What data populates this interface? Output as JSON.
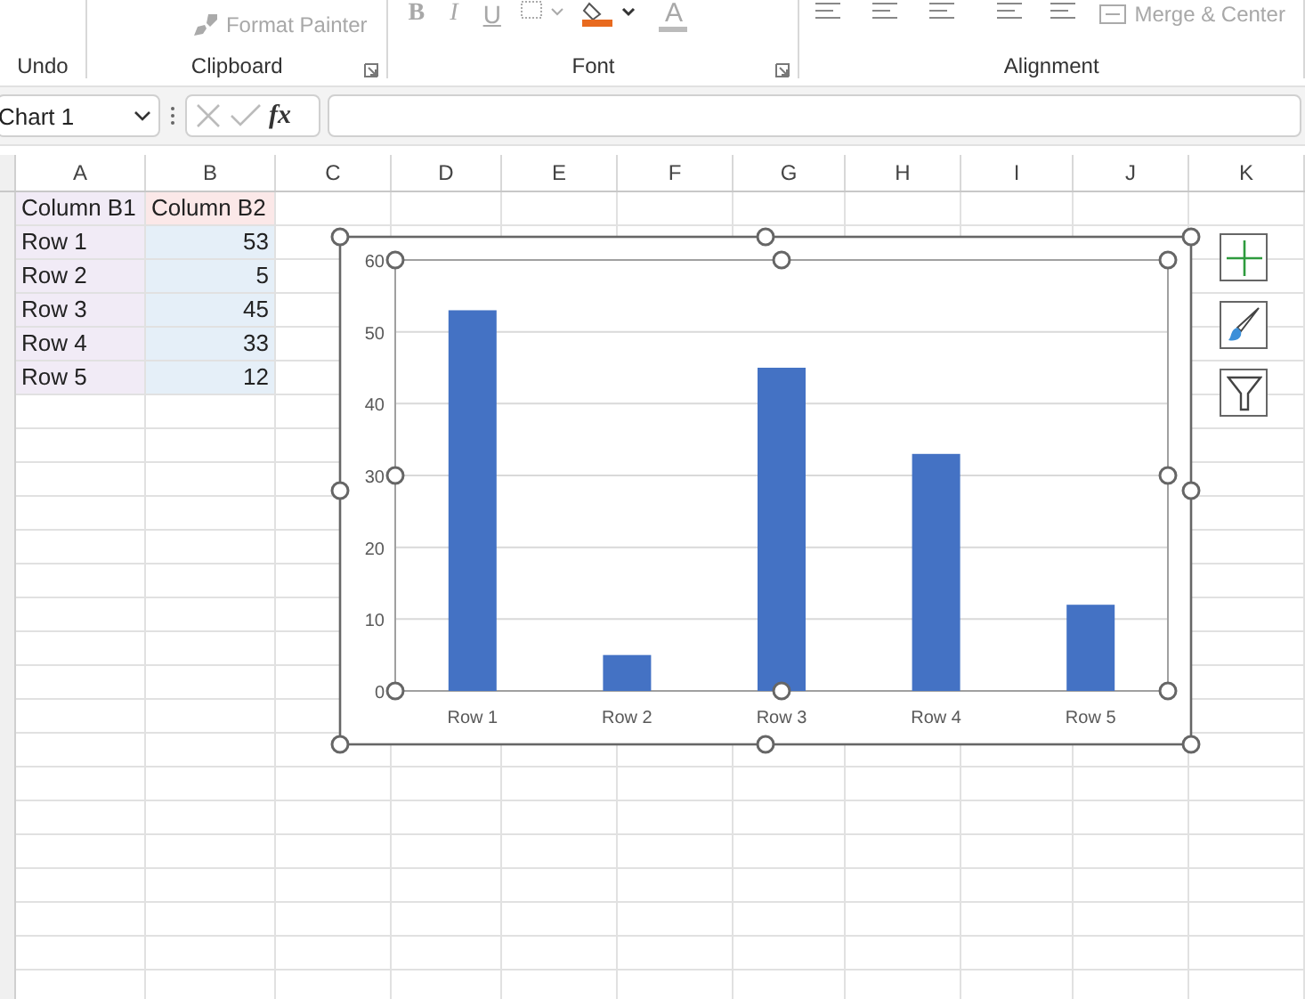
{
  "ribbon": {
    "format_painter": {
      "label": "Format Painter",
      "disabled": true
    },
    "font_buttons": [
      {
        "label": "B",
        "disabled": true
      },
      {
        "label": "I",
        "disabled": true
      },
      {
        "label": "U",
        "disabled": true
      }
    ],
    "font_color": {
      "label": "A",
      "disabled": true
    },
    "merge_center": {
      "label": "Merge & Center",
      "disabled": true
    },
    "groups": [
      {
        "label": "Undo"
      },
      {
        "label": "Clipboard"
      },
      {
        "label": "Font"
      },
      {
        "label": "Alignment"
      }
    ]
  },
  "formula_bar": {
    "name_box": "Chart 1",
    "function_label": "fx"
  },
  "columns": [
    "A",
    "B",
    "C",
    "D",
    "E",
    "F",
    "G",
    "H",
    "I",
    "J",
    "K"
  ],
  "table": {
    "header": [
      "Column B1",
      "Column B2"
    ],
    "rows": [
      {
        "label": "Row 1",
        "value": "53"
      },
      {
        "label": "Row 2",
        "value": "5"
      },
      {
        "label": "Row 3",
        "value": "45"
      },
      {
        "label": "Row 4",
        "value": "33"
      },
      {
        "label": "Row 5",
        "value": "12"
      }
    ]
  },
  "chart": {
    "selected": true,
    "chart_data": {
      "type": "bar",
      "categories": [
        "Row 1",
        "Row 2",
        "Row 3",
        "Row 4",
        "Row 5"
      ],
      "series": [
        {
          "color": "#4472c4",
          "values": [
            53,
            5,
            45,
            33,
            12
          ]
        }
      ],
      "grid": true,
      "ylim": [
        0,
        60
      ],
      "yticks": [
        0,
        10,
        20,
        30,
        40,
        50,
        60
      ]
    }
  }
}
